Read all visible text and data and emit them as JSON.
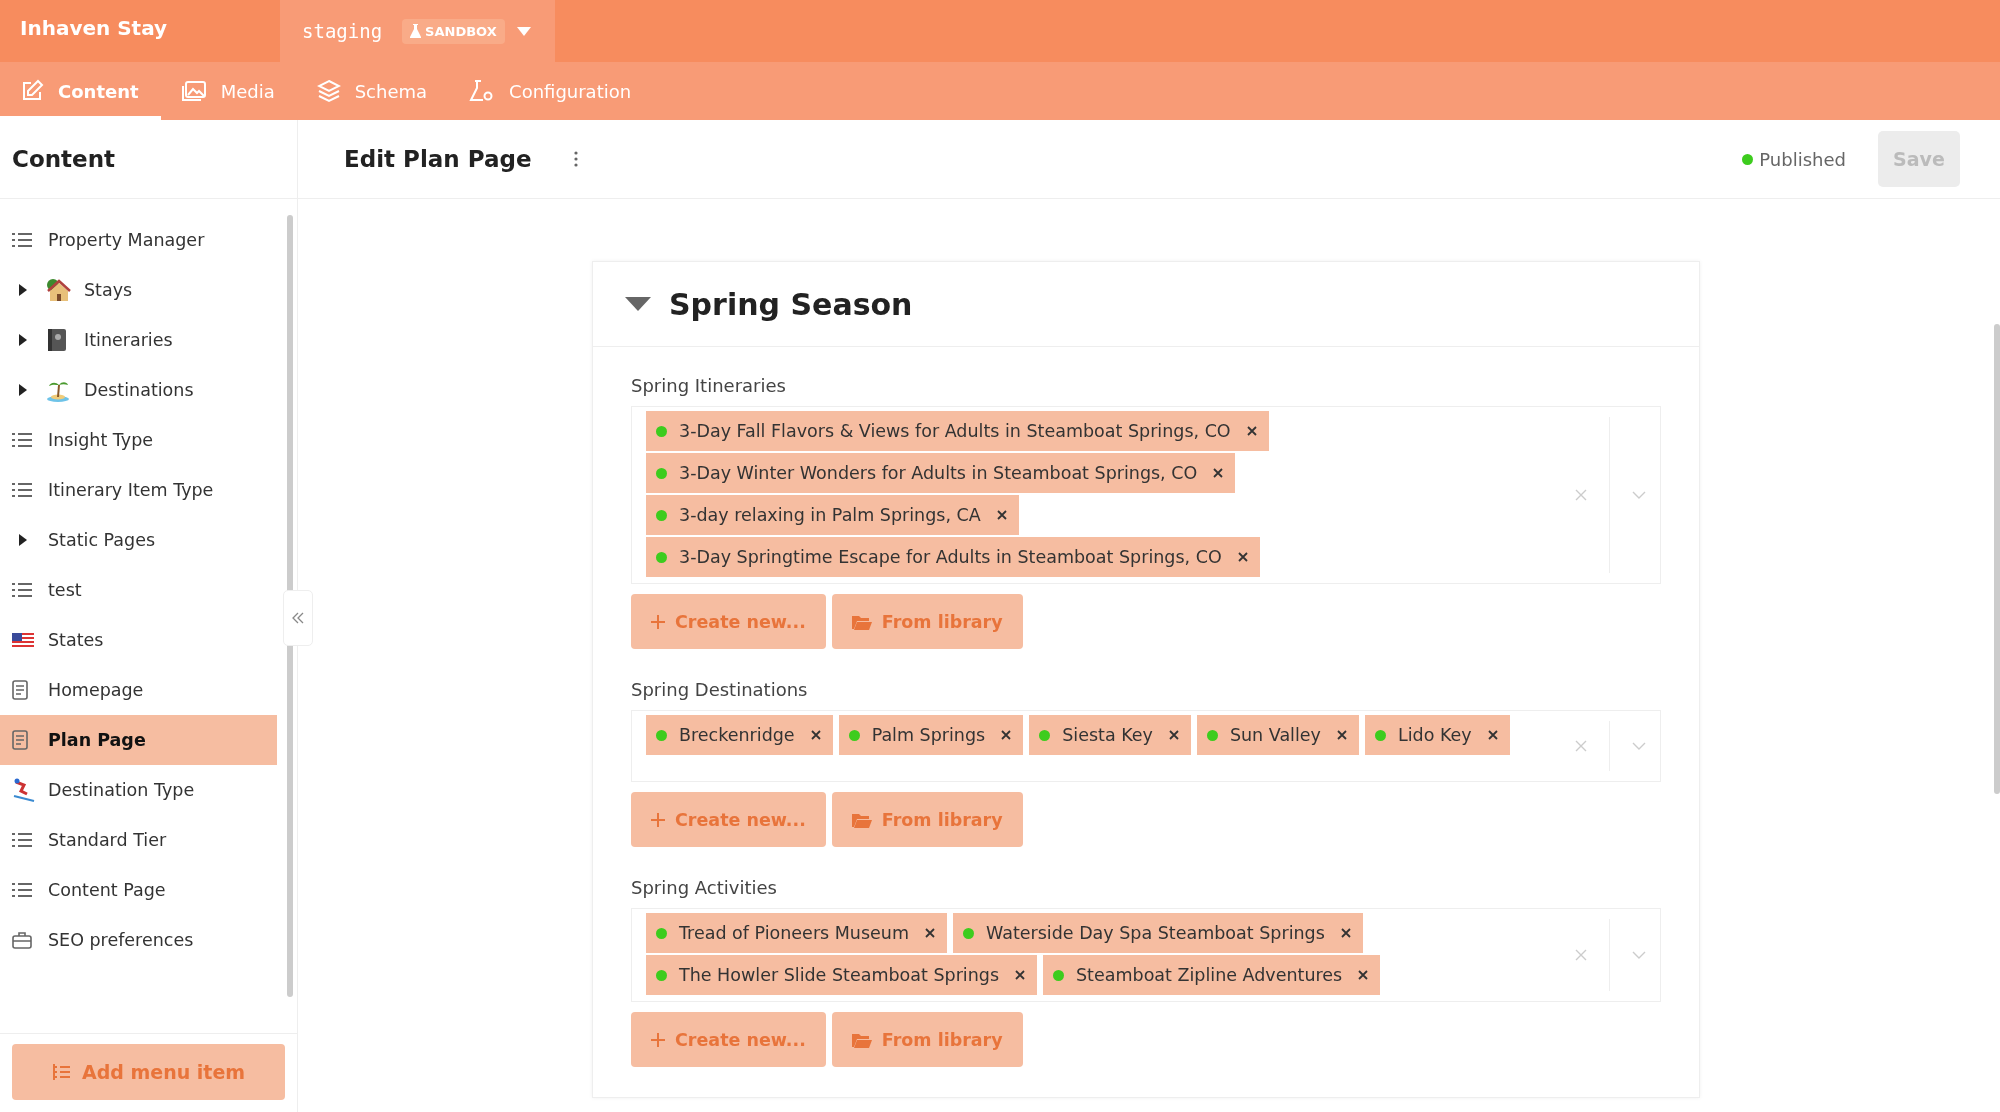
{
  "app": {
    "name": "Inhaven Stay",
    "environment": "staging",
    "environment_badge": "SANDBOX"
  },
  "tabs": [
    {
      "label": "Content",
      "selected": true
    },
    {
      "label": "Media",
      "selected": false
    },
    {
      "label": "Schema",
      "selected": false
    },
    {
      "label": "Configuration",
      "selected": false
    }
  ],
  "sidebar": {
    "title": "Content",
    "add_button": "Add menu item",
    "items": [
      {
        "label": "Property Manager",
        "kind": "list",
        "expandable": false,
        "selected": false
      },
      {
        "label": "Stays",
        "kind": "house",
        "expandable": true,
        "selected": false
      },
      {
        "label": "Itineraries",
        "kind": "book",
        "expandable": true,
        "selected": false
      },
      {
        "label": "Destinations",
        "kind": "island",
        "expandable": true,
        "selected": false
      },
      {
        "label": "Insight Type",
        "kind": "list",
        "expandable": false,
        "selected": false
      },
      {
        "label": "Itinerary Item Type",
        "kind": "list",
        "expandable": false,
        "selected": false
      },
      {
        "label": "Static Pages",
        "kind": "folder",
        "expandable": true,
        "selected": false
      },
      {
        "label": "test",
        "kind": "list",
        "expandable": false,
        "selected": false
      },
      {
        "label": "States",
        "kind": "flag",
        "expandable": false,
        "selected": false
      },
      {
        "label": "Homepage",
        "kind": "page",
        "expandable": false,
        "selected": false
      },
      {
        "label": "Plan Page",
        "kind": "page",
        "expandable": false,
        "selected": true
      },
      {
        "label": "Destination Type",
        "kind": "skier",
        "expandable": false,
        "selected": false
      },
      {
        "label": "Standard Tier",
        "kind": "list",
        "expandable": false,
        "selected": false
      },
      {
        "label": "Content Page",
        "kind": "list",
        "expandable": false,
        "selected": false
      },
      {
        "label": "SEO preferences",
        "kind": "briefcase",
        "expandable": false,
        "selected": false
      }
    ]
  },
  "editor": {
    "title": "Edit Plan Page",
    "status": "Published",
    "save_button": "Save",
    "section": {
      "title": "Spring Season",
      "expanded": true,
      "fields": [
        {
          "label": "Spring Itineraries",
          "create_button": "Create new...",
          "library_button": "From library",
          "items": [
            "3-Day Fall Flavors & Views for Adults in Steamboat Springs, CO",
            "3-Day Winter Wonders for Adults in Steamboat Springs, CO",
            "3-day relaxing in Palm Springs, CA",
            "3-Day Springtime Escape for Adults in Steamboat Springs, CO"
          ]
        },
        {
          "label": "Spring Destinations",
          "create_button": "Create new...",
          "library_button": "From library",
          "items": [
            "Breckenridge",
            "Palm Springs",
            "Siesta Key",
            "Sun Valley",
            "Lido Key"
          ]
        },
        {
          "label": "Spring Activities",
          "create_button": "Create new...",
          "library_button": "From library",
          "items": [
            "Tread of Pioneers Museum",
            "Waterside Day Spa Steamboat Springs",
            "The Howler Slide Steamboat Springs",
            "Steamboat Zipline Adventures"
          ]
        }
      ]
    }
  }
}
